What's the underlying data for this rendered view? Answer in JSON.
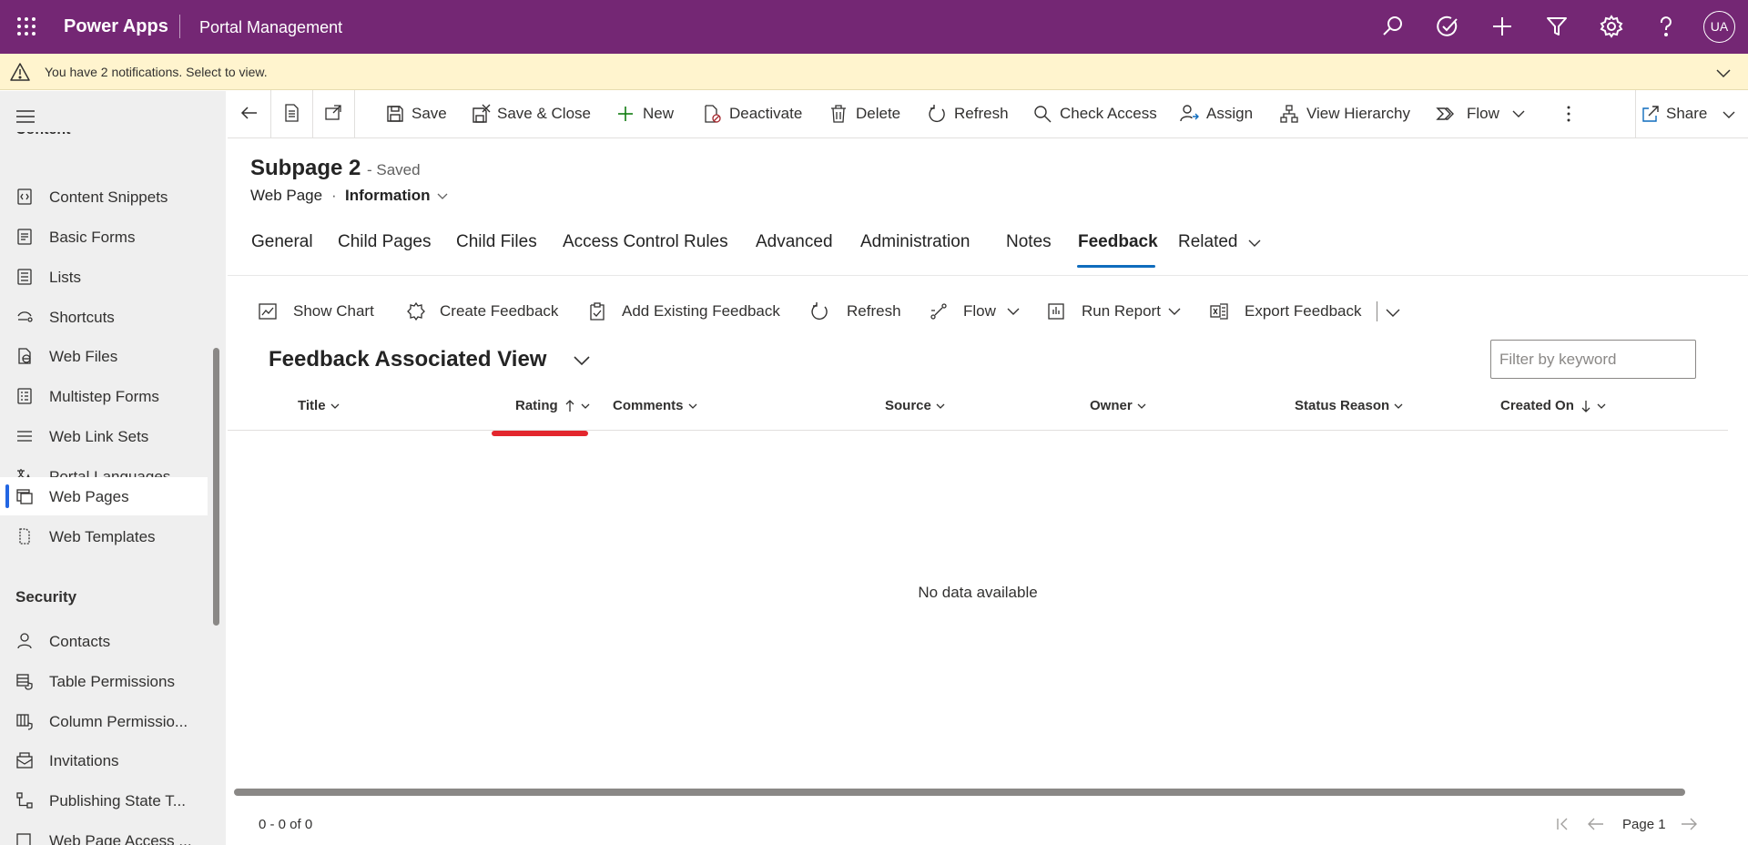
{
  "topbar": {
    "app_name": "Power Apps",
    "portal_name": "Portal Management",
    "icons": [
      "search-icon",
      "task-check-icon",
      "add-icon",
      "filter-icon",
      "settings-icon",
      "help-icon"
    ],
    "avatar_initials": "UA",
    "background_color": "#742774"
  },
  "notification": {
    "text": "You have 2 notifications. Select to view."
  },
  "sidebar": {
    "partial_group_label": "Content",
    "items": [
      {
        "label": "Content Snippets",
        "icon": "snippet-icon"
      },
      {
        "label": "Basic Forms",
        "icon": "form-icon"
      },
      {
        "label": "Lists",
        "icon": "list-icon"
      },
      {
        "label": "Shortcuts",
        "icon": "shortcut-icon"
      },
      {
        "label": "Web Files",
        "icon": "web-file-icon"
      },
      {
        "label": "Multistep Forms",
        "icon": "multistep-form-icon"
      },
      {
        "label": "Web Link Sets",
        "icon": "link-set-icon"
      },
      {
        "label": "Portal Languages",
        "icon": "language-icon"
      },
      {
        "label": "Web Pages",
        "icon": "web-page-icon",
        "active": true
      },
      {
        "label": "Web Templates",
        "icon": "template-icon"
      }
    ],
    "security_label": "Security",
    "security_items": [
      {
        "label": "Contacts",
        "icon": "contact-icon"
      },
      {
        "label": "Table Permissions",
        "icon": "table-permission-icon"
      },
      {
        "label": "Column Permissio...",
        "icon": "column-permission-icon"
      },
      {
        "label": "Invitations",
        "icon": "invitation-icon"
      },
      {
        "label": "Publishing State T...",
        "icon": "publishing-icon"
      },
      {
        "label": "Web Page Access ...",
        "icon": "access-icon"
      }
    ]
  },
  "commandbar": {
    "save": "Save",
    "save_close": "Save & Close",
    "new": "New",
    "deactivate": "Deactivate",
    "delete": "Delete",
    "refresh": "Refresh",
    "check_access": "Check Access",
    "assign": "Assign",
    "view_hierarchy": "View Hierarchy",
    "flow": "Flow",
    "share": "Share"
  },
  "record": {
    "title": "Subpage 2",
    "saved_status": "- Saved",
    "entity": "Web Page",
    "separator": "·",
    "form": "Information"
  },
  "tabs": [
    "General",
    "Child Pages",
    "Child Files",
    "Access Control Rules",
    "Advanced",
    "Administration",
    "Notes",
    "Feedback",
    "Related"
  ],
  "active_tab": "Feedback",
  "subgrid": {
    "commands": {
      "show_chart": "Show Chart",
      "create_feedback": "Create Feedback",
      "add_existing": "Add Existing Feedback",
      "refresh": "Refresh",
      "flow": "Flow",
      "run_report": "Run Report",
      "export": "Export Feedback"
    },
    "view_title": "Feedback Associated View",
    "filter_placeholder": "Filter by keyword",
    "columns": {
      "title": "Title",
      "rating": "Rating",
      "comments": "Comments",
      "source": "Source",
      "owner": "Owner",
      "status_reason": "Status Reason",
      "created_on": "Created On"
    },
    "sorted_ascending_column": "Rating",
    "sorted_descending_column": "Created On",
    "empty_message": "No data available",
    "record_count": "0 - 0 of 0",
    "page_label": "Page 1"
  }
}
